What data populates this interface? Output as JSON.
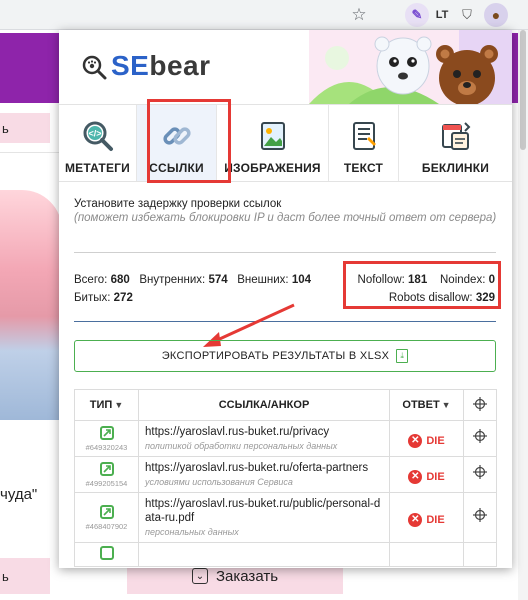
{
  "browser": {
    "icons": [
      "star-icon",
      "pen-extension-icon",
      "languagetool-icon",
      "shield-extension-icon",
      "sebear-extension-icon"
    ],
    "lt_label": "LT"
  },
  "background_page": {
    "pink_label": "ь",
    "text_fragment": "чуда\"",
    "bottom_left_label": "ь",
    "order_button": "Заказать",
    "accent_color": "#8e24aa"
  },
  "popup": {
    "logo": {
      "part1": "SE",
      "part2": "bear"
    },
    "tabs": [
      {
        "label": "МЕТАТЕГИ",
        "icon": "code-magnifier-icon"
      },
      {
        "label": "ССЫЛКИ",
        "icon": "chain-link-icon",
        "active": true
      },
      {
        "label": "ИЗОБРАЖЕНИЯ",
        "icon": "image-icon"
      },
      {
        "label": "ТЕКСТ",
        "icon": "text-document-icon"
      },
      {
        "label": "БЕКЛИНКИ",
        "icon": "backlinks-icon"
      }
    ],
    "delay": {
      "text": "Установите задержку проверки ссылок",
      "hint": "(поможет избежать блокировки IP и даст более точный ответ от сервера)"
    },
    "stats": {
      "total_label": "Всего:",
      "total": "680",
      "internal_label": "Внутренних:",
      "internal": "574",
      "external_label": "Внешних:",
      "external": "104",
      "broken_label": "Битых:",
      "broken": "272",
      "nofollow_label": "Nofollow:",
      "nofollow": "181",
      "noindex_label": "Noindex:",
      "noindex": "0",
      "robots_label": "Robots disallow:",
      "robots": "329"
    },
    "export_button": "ЭКСПОРТИРОВАТЬ РЕЗУЛЬТАТЫ В XLSX",
    "table": {
      "headers": {
        "type": "ТИП",
        "link": "ССЫЛКА/АНКОР",
        "response": "ОТВЕТ"
      },
      "rows": [
        {
          "id": "#649320243",
          "url": "https://yaroslavl.rus-buket.ru/privacy",
          "anchor": "политикой обработки персональных данных",
          "status": "DIE"
        },
        {
          "id": "#499205154",
          "url": "https://yaroslavl.rus-buket.ru/oferta-partners",
          "anchor": "условиями использования Сервиса",
          "status": "DIE"
        },
        {
          "id": "#468407902",
          "url": "https://yaroslavl.rus-buket.ru/public/personal-data-ru.pdf",
          "anchor": "персональных данных",
          "status": "DIE"
        }
      ]
    },
    "colors": {
      "brand_blue": "#2b62c8",
      "highlight_red": "#e53935",
      "export_green": "#4caf50",
      "die_red": "#e53935"
    }
  }
}
